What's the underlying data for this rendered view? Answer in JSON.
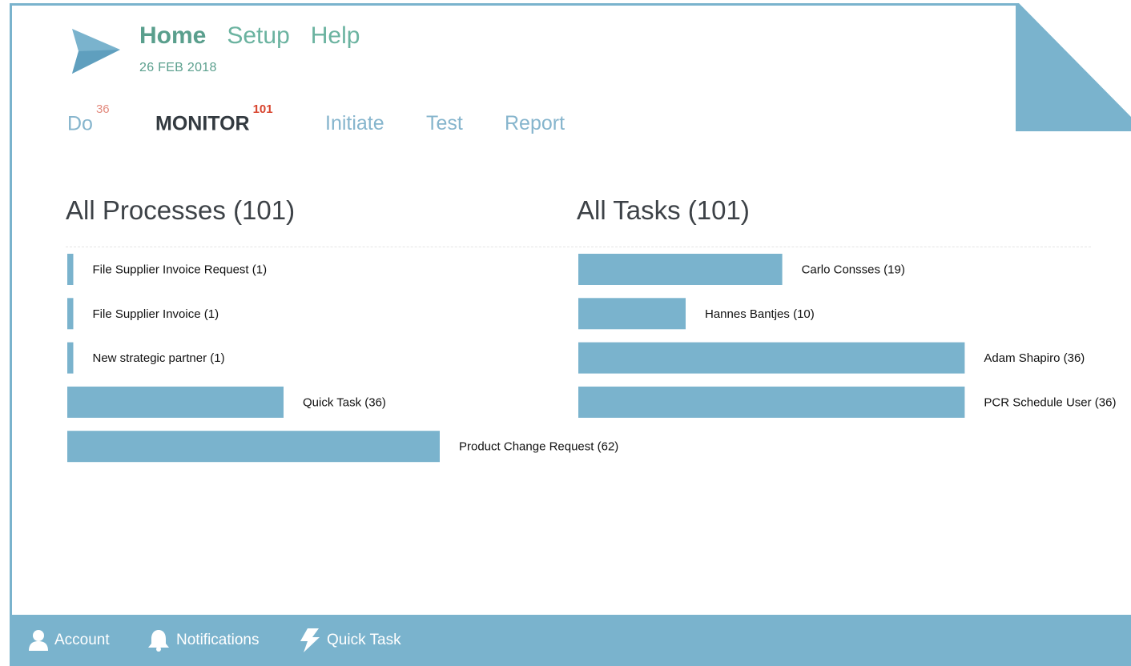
{
  "header": {
    "nav": [
      "Home",
      "Setup",
      "Help"
    ],
    "date": "26 FEB 2018"
  },
  "tabs": [
    {
      "label": "Do",
      "count": "36"
    },
    {
      "label": "MONITOR",
      "count": "101"
    },
    {
      "label": "Initiate"
    },
    {
      "label": "Test"
    },
    {
      "label": "Report"
    }
  ],
  "processes": {
    "title": "All Processes (101)"
  },
  "tasks": {
    "title": "All Tasks (101)"
  },
  "footer": {
    "items": [
      {
        "label": "Account",
        "icon": "user-icon"
      },
      {
        "label": "Notifications",
        "icon": "bell-icon"
      },
      {
        "label": "Quick Task",
        "icon": "lightning-icon"
      }
    ]
  },
  "colors": {
    "bar": "#7ab3cd",
    "accent": "#6bb3a0",
    "badge": "#d8452f",
    "tab": "#86b5cd"
  },
  "chart_data": [
    {
      "type": "bar",
      "orientation": "horizontal",
      "title": "All Processes (101)",
      "categories": [
        "File Supplier Invoice Request",
        "File Supplier Invoice",
        "New strategic partner",
        "Quick Task",
        "Product Change Request"
      ],
      "values": [
        1,
        1,
        1,
        36,
        62
      ],
      "labels": [
        "File Supplier Invoice Request (1)",
        "File Supplier Invoice (1)",
        "New strategic partner (1)",
        "Quick Task (36)",
        "Product Change Request (62)"
      ]
    },
    {
      "type": "bar",
      "orientation": "horizontal",
      "title": "All Tasks (101)",
      "categories": [
        "Carlo Consses",
        "Hannes Bantjes",
        "Adam Shapiro",
        "PCR Schedule User"
      ],
      "values": [
        19,
        10,
        36,
        36
      ],
      "labels": [
        "Carlo Consses (19)",
        "Hannes Bantjes (10)",
        "Adam Shapiro (36)",
        "PCR Schedule User (36)"
      ]
    }
  ]
}
